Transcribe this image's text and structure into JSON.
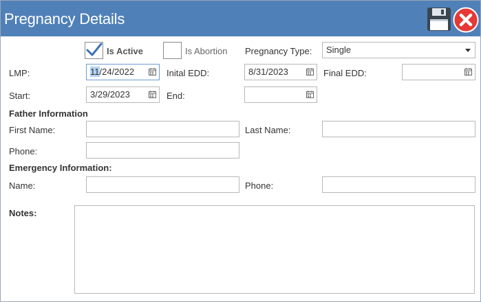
{
  "window": {
    "title": "Pregnancy Details"
  },
  "status": {
    "is_active_label": "Is Active",
    "is_active_checked": true,
    "is_abortion_label": "Is Abortion",
    "is_abortion_checked": false,
    "pregnancy_type_label": "Pregnancy Type:",
    "pregnancy_type_value": "Single"
  },
  "dates": {
    "lmp_label": "LMP:",
    "lmp_selected": "11",
    "lmp_rest": "/24/2022",
    "initial_edd_label": "Inital EDD:",
    "initial_edd_value": "8/31/2023",
    "final_edd_label": "Final EDD:",
    "final_edd_value": "",
    "start_label": "Start:",
    "start_value": "3/29/2023",
    "end_label": "End:",
    "end_value": ""
  },
  "father": {
    "heading": "Father Information",
    "first_name_label": "First Name:",
    "first_name_value": "",
    "last_name_label": "Last Name:",
    "last_name_value": "",
    "phone_label": "Phone:",
    "phone_value": ""
  },
  "emergency": {
    "heading": "Emergency Information:",
    "name_label": "Name:",
    "name_value": "",
    "phone_label": "Phone:",
    "phone_value": ""
  },
  "notes": {
    "label": "Notes:",
    "value": ""
  },
  "icons": {
    "save": "floppy-disk-icon",
    "close": "close-circle-icon",
    "calendar": "calendar-icon",
    "dropdown": "chevron-down-icon",
    "check": "checkmark-icon"
  },
  "colors": {
    "titlebar": "#5080b8",
    "close_red": "#e53935",
    "check_blue": "#3f72b5"
  }
}
